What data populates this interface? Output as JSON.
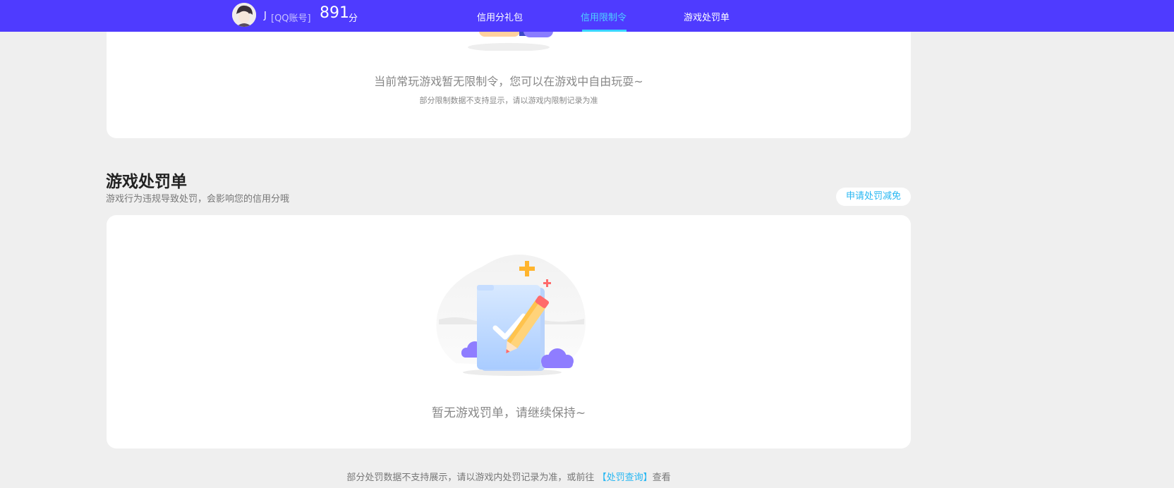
{
  "header": {
    "user_name": "J",
    "account_type": "[QQ账号]",
    "score": "891",
    "score_unit": "分",
    "tabs": [
      {
        "label": "信用分礼包"
      },
      {
        "label": "信用限制令"
      },
      {
        "label": "游戏处罚单"
      }
    ],
    "active_tab": "信用限制令",
    "brand_color": "#4f3bff",
    "active_color": "#4fd3ff"
  },
  "restriction_card": {
    "message": "当前常玩游戏暂无限制令，您可以在游戏中自由玩耍~",
    "note": "部分限制数据不支持显示，请以游戏内限制记录为准"
  },
  "penalty_section": {
    "title": "游戏处罚单",
    "description": "游戏行为违规导致处罚，会影响您的信用分哦",
    "apply_button": "申请处罚减免",
    "empty_message": "暂无游戏罚单，请继续保持~"
  },
  "footer": {
    "note_prefix": "部分处罚数据不支持展示，请以游戏内处罚记录为准，或前往",
    "link": "【处罚查询】",
    "note_suffix": "查看",
    "link_color": "#27b7f2"
  }
}
